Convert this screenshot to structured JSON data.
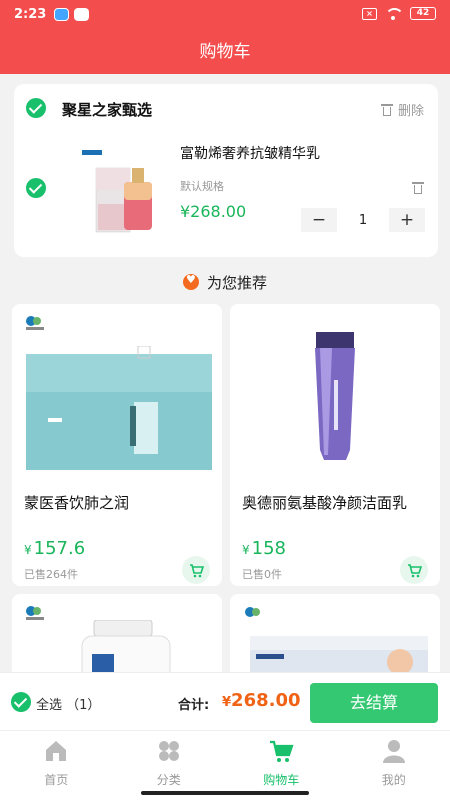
{
  "status_bar": {
    "time": "2:23",
    "battery": "42"
  },
  "header": {
    "title": "购物车"
  },
  "cart": {
    "shop_name": "聚星之家甄选",
    "delete_label": "删除",
    "item": {
      "name": "富勒烯奢养抗皱精华乳",
      "spec": "默认规格",
      "price": "¥268.00",
      "quantity": "1",
      "minus": "−",
      "plus": "+"
    }
  },
  "recommend": {
    "title": "为您推荐",
    "items": [
      {
        "name": "蒙医香饮肺之润",
        "currency": "¥",
        "price": "157.6",
        "sold": "已售264件"
      },
      {
        "name": "奥德丽氨基酸净颜洁面乳",
        "currency": "¥",
        "price": "158",
        "sold": "已售0件"
      }
    ]
  },
  "checkout": {
    "select_all": "全选 （1）",
    "total_label": "合计:",
    "total_currency": "¥",
    "total_value": "268.00",
    "button": "去结算"
  },
  "tabs": [
    {
      "label": "首页",
      "icon": "home-icon",
      "active": false
    },
    {
      "label": "分类",
      "icon": "category-icon",
      "active": false
    },
    {
      "label": "购物车",
      "icon": "cart-icon",
      "active": true
    },
    {
      "label": "我的",
      "icon": "profile-icon",
      "active": false
    }
  ],
  "colors": {
    "header": "#f44d4d",
    "accent": "#18c06b",
    "price": "#18b55a",
    "total": "#f06214",
    "checkout_button": "#35c873"
  }
}
